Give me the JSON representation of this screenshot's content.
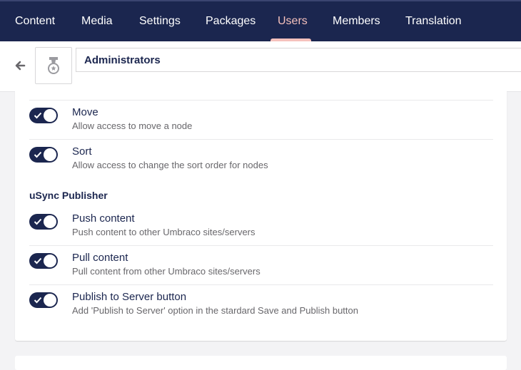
{
  "nav": {
    "items": [
      {
        "label": "Content",
        "active": false
      },
      {
        "label": "Media",
        "active": false
      },
      {
        "label": "Settings",
        "active": false
      },
      {
        "label": "Packages",
        "active": false
      },
      {
        "label": "Users",
        "active": true
      },
      {
        "label": "Members",
        "active": false
      },
      {
        "label": "Translation",
        "active": false
      }
    ]
  },
  "header": {
    "back_icon": "arrow-left-icon",
    "group_icon": "medal-icon",
    "group_name": "Administrators"
  },
  "permissions": {
    "items": [
      {
        "title": "Move",
        "description": "Allow access to move a node",
        "enabled": true
      },
      {
        "title": "Sort",
        "description": "Allow access to change the sort order for nodes",
        "enabled": true
      }
    ]
  },
  "usync": {
    "heading": "uSync Publisher",
    "items": [
      {
        "title": "Push content",
        "description": "Push content to other Umbraco sites/servers",
        "enabled": true
      },
      {
        "title": "Pull content",
        "description": "Pull content from other Umbraco sites/servers",
        "enabled": true
      },
      {
        "title": "Publish to Server button",
        "description": "Add 'Publish to Server' option in the stardard Save and Publish button",
        "enabled": true
      }
    ]
  },
  "colors": {
    "nav_bg": "#1b264f",
    "nav_active": "#f5c1bc",
    "toggle_on": "#1b264f",
    "description_text": "#68676b"
  }
}
